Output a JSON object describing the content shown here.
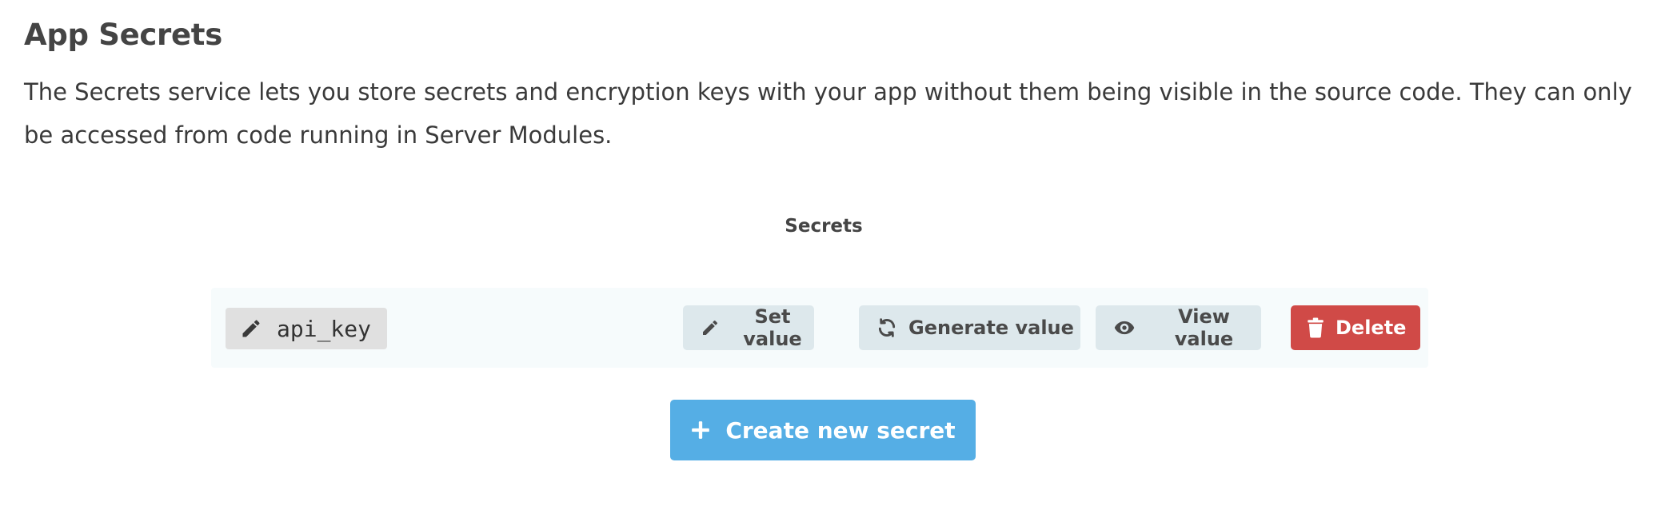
{
  "page": {
    "title": "App Secrets",
    "description": "The Secrets service lets you store secrets and encryption keys with your app without them being visible in the source code. They can only be accessed from code running in Server Modules."
  },
  "secrets_section": {
    "heading": "Secrets",
    "items": [
      {
        "name": "api_key",
        "name_icon": "pencil-icon",
        "actions": {
          "set_value": {
            "label": "Set value",
            "icon": "pencil-icon"
          },
          "generate_value": {
            "label": "Generate value",
            "icon": "refresh-icon"
          },
          "view_value": {
            "label": "View value",
            "icon": "eye-icon"
          },
          "delete": {
            "label": "Delete",
            "icon": "trash-icon"
          }
        }
      }
    ]
  },
  "create_button": {
    "label": "Create new secret",
    "icon": "plus-icon"
  },
  "colors": {
    "primary": "#55aee5",
    "danger": "#d04a47",
    "secondary_button": "#dde8ec",
    "row_background": "#f6fbfc",
    "name_chip": "#e0e0e0",
    "text": "#3a3a3a"
  }
}
